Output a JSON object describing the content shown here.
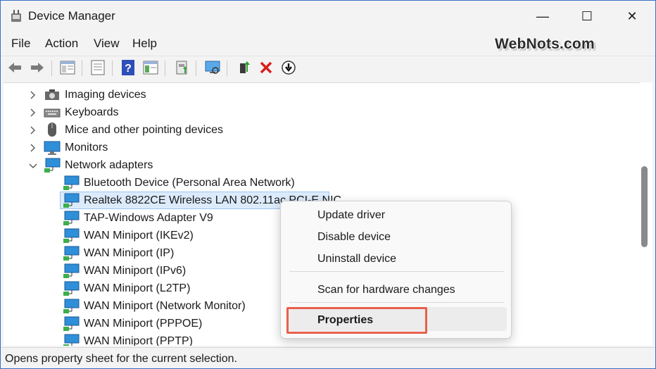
{
  "window": {
    "title": "Device Manager"
  },
  "controls": {
    "minimize": "—",
    "maximize": "☐",
    "close": "✕"
  },
  "menu": [
    "File",
    "Action",
    "View",
    "Help"
  ],
  "watermark": "WebNots.com",
  "toolbar": {
    "icons": [
      "back-icon",
      "forward-icon",
      "show-hide-tree-icon",
      "properties-icon",
      "help-icon",
      "action-view-icon",
      "update-driver-icon",
      "scan-hardware-icon",
      "enable-device-icon",
      "uninstall-icon",
      "disable-icon"
    ]
  },
  "tree": {
    "categories": [
      {
        "label": "Imaging devices",
        "icon": "camera-icon",
        "expanded": false
      },
      {
        "label": "Keyboards",
        "icon": "keyboard-icon",
        "expanded": false
      },
      {
        "label": "Mice and other pointing devices",
        "icon": "mouse-icon",
        "expanded": false
      },
      {
        "label": "Monitors",
        "icon": "monitor-icon",
        "expanded": false
      },
      {
        "label": "Network adapters",
        "icon": "network-adapter-icon",
        "expanded": true
      }
    ],
    "network_adapters": [
      "Bluetooth Device (Personal Area Network)",
      "Realtek 8822CE Wireless LAN 802.11ac PCI-E NIC",
      "TAP-Windows Adapter V9",
      "WAN Miniport (IKEv2)",
      "WAN Miniport (IP)",
      "WAN Miniport (IPv6)",
      "WAN Miniport (L2TP)",
      "WAN Miniport (Network Monitor)",
      "WAN Miniport (PPPOE)",
      "WAN Miniport (PPTP)"
    ],
    "selected": "Realtek 8822CE Wireless LAN 802.11ac PCI-E NIC"
  },
  "context_menu": {
    "items": [
      "Update driver",
      "Disable device",
      "Uninstall device",
      "Scan for hardware changes",
      "Properties"
    ],
    "highlighted": "Properties"
  },
  "status": "Opens property sheet for the current selection.",
  "colors": {
    "accent": "#3a6fc8",
    "highlight_border": "#e8604c",
    "selection": "#dcebfc",
    "network_icon": "#2f8fd8"
  }
}
